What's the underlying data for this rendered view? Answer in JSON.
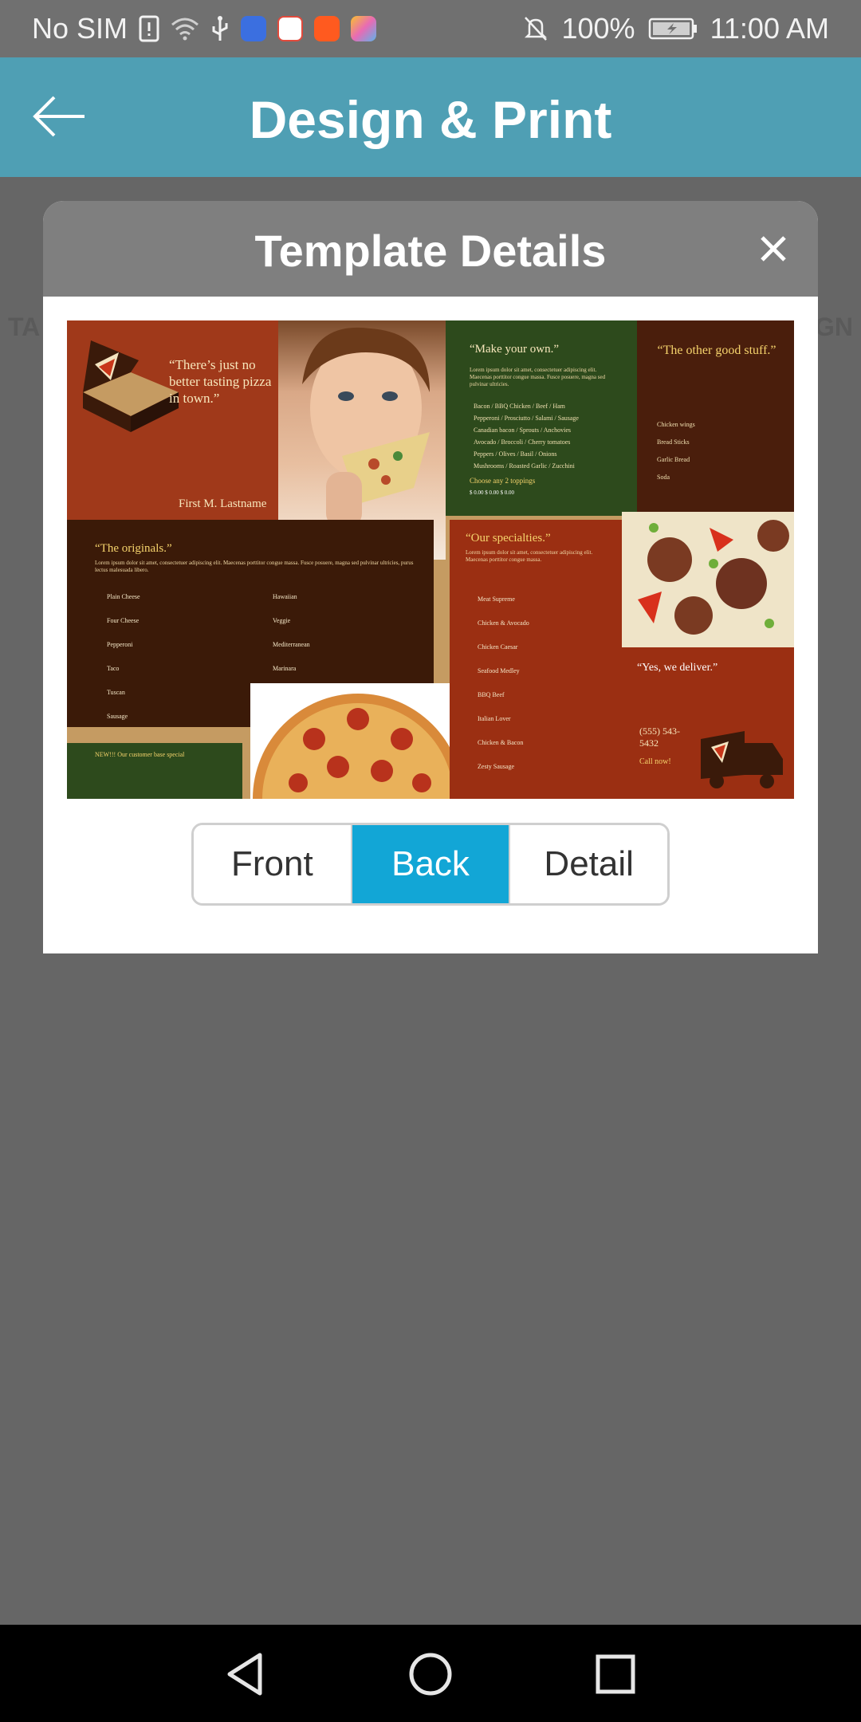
{
  "status_bar": {
    "carrier": "No SIM",
    "battery": "100%",
    "time": "11:00 AM",
    "icons": [
      "sim-alert-icon",
      "wifi-icon",
      "usb-icon",
      "music-app-icon",
      "du-app-icon",
      "video-app-icon",
      "photos-app-icon",
      "mute-icon",
      "battery-charging-icon"
    ]
  },
  "app_bar": {
    "title": "Design & Print",
    "back_icon": "back-arrow-icon"
  },
  "background": {
    "left_peek": "TA",
    "right_peek": "GN"
  },
  "dialog": {
    "title": "Template Details",
    "close_icon": "close-icon",
    "tabs": [
      {
        "label": "Front",
        "active": false
      },
      {
        "label": "Back",
        "active": true
      },
      {
        "label": "Detail",
        "active": false
      }
    ]
  },
  "brochure": {
    "quote_top_left": "“There’s just no better tasting pizza in town.”",
    "signature": "First M. Lastname",
    "make_your_own": "“Make your own.”",
    "toppings_line1": "Bacon / BBQ Chicken / Beef / Ham",
    "toppings_line2": "Pepperoni / Prosciutto / Salami / Sausage",
    "toppings_line3": "Canadian bacon / Sprouts / Anchovies",
    "toppings_line4": "Avocado / Broccoli / Cherry tomatoes",
    "toppings_line5": "Peppers / Olives / Basil / Onions",
    "toppings_line6": "Mushrooms / Roasted Garlic / Zucchini",
    "choose_toppings": "Choose any 2 toppings",
    "other_good_stuff": "“The other good stuff.”",
    "originals": "“The originals.”",
    "specialties": "“Our specialties.”",
    "deliver": "“Yes, we deliver.”",
    "phone": "(555) 543-5432",
    "call_now": "Call now!",
    "new_customer": "NEW!!! Our customer base special",
    "originals_items": [
      "Plain Cheese",
      "Four Cheese",
      "Pepperoni",
      "Taco",
      "Tuscan",
      "Sausage"
    ],
    "originals_items_right": [
      "Hawaiian",
      "Veggie",
      "Mediterranean",
      "Marinara"
    ],
    "specialty_items": [
      "Meat Supreme",
      "Chicken & Avocado",
      "Chicken Caesar",
      "Seafood Medley",
      "BBQ Beef",
      "Italian Lover",
      "Chicken & Bacon",
      "Zesty Sausage"
    ],
    "other_items": [
      "Chicken wings",
      "Bread Sticks",
      "Garlic Bread",
      "Soda"
    ],
    "prices": "$ 0.00  $ 0.00  $ 0.00"
  }
}
